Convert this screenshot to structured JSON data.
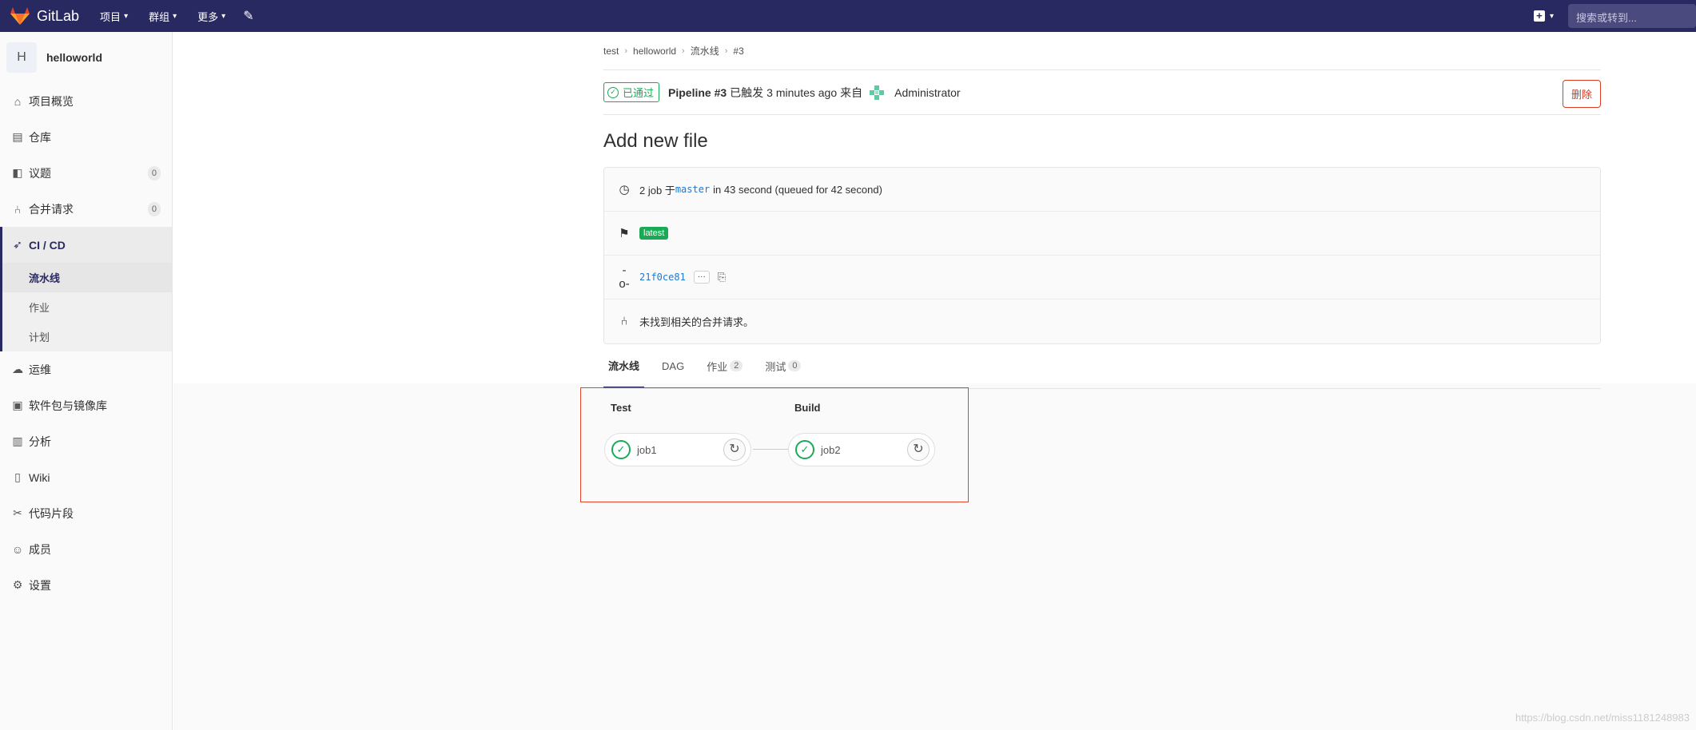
{
  "topbar": {
    "logo_text": "GitLab",
    "nav": [
      "项目",
      "群组",
      "更多"
    ],
    "search_placeholder": "搜索或转到..."
  },
  "sidebar": {
    "project_initial": "H",
    "project_name": "helloworld",
    "items": [
      {
        "label": "项目概览",
        "icon": "home-icon"
      },
      {
        "label": "仓库",
        "icon": "doc-icon"
      },
      {
        "label": "议题",
        "icon": "issues-icon",
        "count": "0"
      },
      {
        "label": "合并请求",
        "icon": "merge-icon",
        "count": "0"
      },
      {
        "label": "CI / CD",
        "icon": "rocket-icon"
      },
      {
        "label": "运维",
        "icon": "cloud-icon"
      },
      {
        "label": "软件包与镜像库",
        "icon": "package-icon"
      },
      {
        "label": "分析",
        "icon": "chart-icon"
      },
      {
        "label": "Wiki",
        "icon": "book-icon"
      },
      {
        "label": "代码片段",
        "icon": "scissors-icon"
      },
      {
        "label": "成员",
        "icon": "users-icon"
      },
      {
        "label": "设置",
        "icon": "gear-icon"
      }
    ],
    "cicd_sub": [
      "流水线",
      "作业",
      "计划"
    ]
  },
  "breadcrumb": [
    "test",
    "helloworld",
    "流水线",
    "#3"
  ],
  "pipeline": {
    "status": "已通过",
    "id": "Pipeline #3",
    "triggered": "已触发",
    "time": "3 minutes ago",
    "from": "来自",
    "user": "Administrator",
    "delete_label": "删除"
  },
  "commit_title": "Add new file",
  "info": {
    "jobs_prefix": "2 job 于",
    "branch": "master",
    "jobs_suffix": "in 43 second (queued for 42 second)",
    "tag": "latest",
    "sha": "21f0ce81",
    "dots": "···",
    "mr_text": "未找到相关的合并请求。"
  },
  "tabs": [
    {
      "label": "流水线",
      "count": null
    },
    {
      "label": "DAG",
      "count": null
    },
    {
      "label": "作业",
      "count": "2"
    },
    {
      "label": "测试",
      "count": "0"
    }
  ],
  "stages": [
    {
      "title": "Test",
      "job": "job1"
    },
    {
      "title": "Build",
      "job": "job2"
    }
  ],
  "watermark": "https://blog.csdn.net/miss1181248983"
}
